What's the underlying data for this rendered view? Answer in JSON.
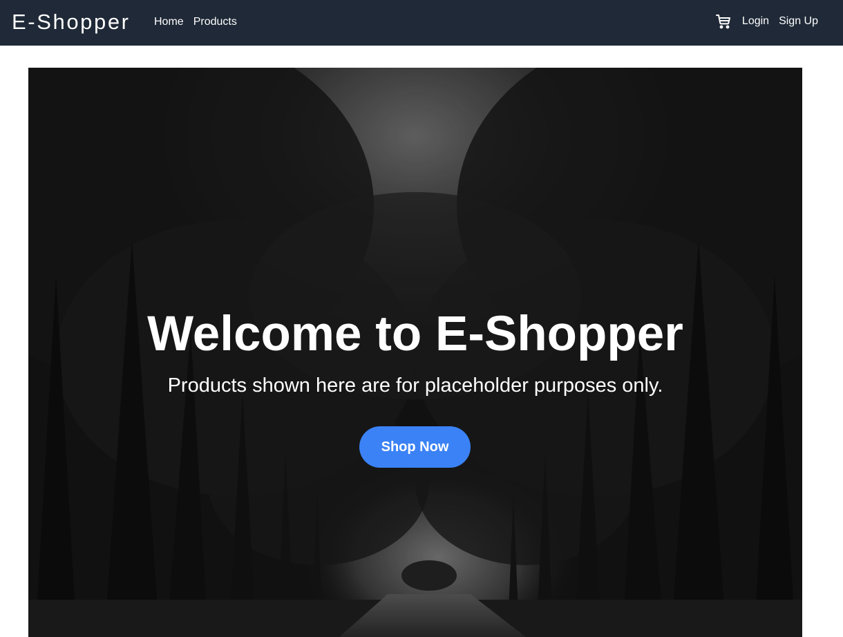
{
  "navbar": {
    "brand": "E-Shopper",
    "links": {
      "home": "Home",
      "products": "Products"
    },
    "cart_icon": "cart-icon",
    "auth": {
      "login": "Login",
      "signup": "Sign Up"
    }
  },
  "hero": {
    "title": "Welcome to E-Shopper",
    "subtitle": "Products shown here are for placeholder purposes only.",
    "cta_label": "Shop Now",
    "background": "dark forest road image"
  },
  "colors": {
    "navbar_bg": "#1f2937",
    "accent": "#3b82f6",
    "text_light": "#ffffff"
  }
}
